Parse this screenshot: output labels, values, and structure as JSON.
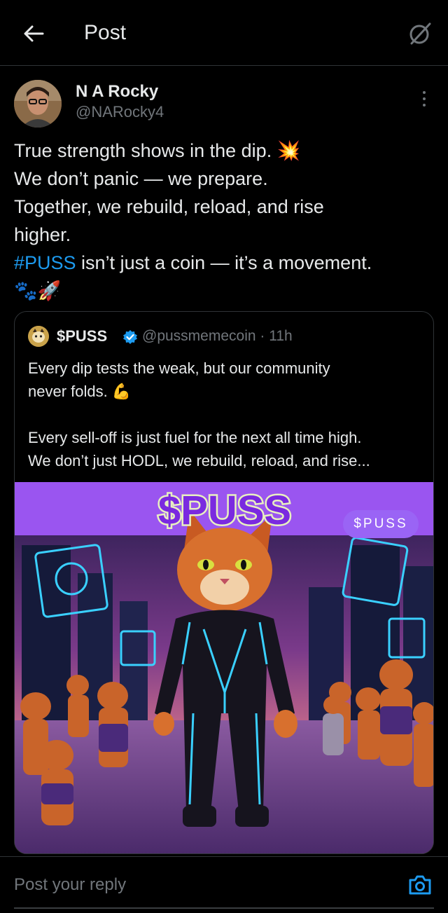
{
  "header": {
    "title": "Post",
    "back_icon": "arrow-left-icon",
    "grok_icon": "slash-circle-icon"
  },
  "post": {
    "author_name": "N A Rocky",
    "author_handle": "@NARocky4",
    "lines": [
      "True strength shows in the dip. 💥",
      "We don’t panic — we prepare.",
      "Together, we rebuild, reload, and rise",
      "higher."
    ],
    "hashtag": "#PUSS",
    "hashtag_rest": " isn’t just a coin — it’s a movement.",
    "emoji_line": "🐾🚀"
  },
  "quote": {
    "name": "$PUSS",
    "handle_time": "@pussmemecoin · 11h",
    "para1_line1": "Every dip tests the weak, but our community",
    "para1_line2": "never folds. 💪",
    "para2_line1": "Every sell-off is just fuel for the next all time high.",
    "para2_line2": "We don’t just HODL, we rebuild, reload, and rise...",
    "media_title": "$PUSS",
    "media_badge": "$PUSS"
  },
  "reply": {
    "placeholder": "Post your reply",
    "camera_icon": "camera-icon"
  },
  "colors": {
    "background": "#000000",
    "text": "#e7e9ea",
    "muted": "#71767b",
    "link": "#1d9bf0",
    "accent_purple": "#9a64f5"
  }
}
